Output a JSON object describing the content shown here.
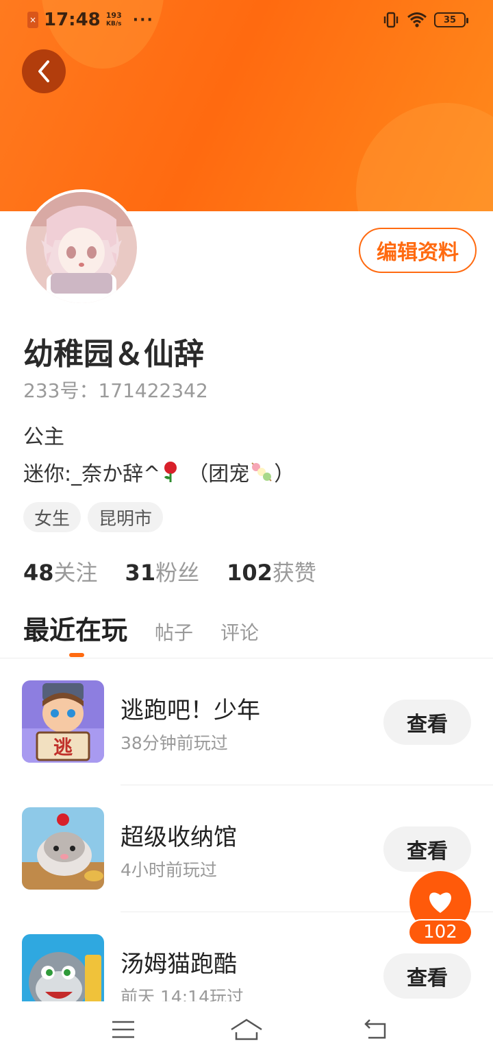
{
  "status_bar": {
    "time": "17:48",
    "speed_value": "193",
    "speed_unit": "KB/s",
    "more": "···",
    "battery": "35"
  },
  "profile": {
    "username": "幼稚园＆仙辞",
    "id_label": "233号：",
    "id_value": "171422342",
    "bio_line1": "公主",
    "bio_line2_prefix": "迷你:_奈か辞^",
    "bio_line2_mid": "（团宠",
    "bio_line2_suffix": "）",
    "tags": [
      "女生",
      "昆明市"
    ],
    "edit_label": "编辑资料"
  },
  "stats": {
    "following_num": "48",
    "following_label": "关注",
    "fans_num": "31",
    "fans_label": "粉丝",
    "likes_num": "102",
    "likes_label": "获赞"
  },
  "tabs": [
    "最近在玩",
    "帖子",
    "评论"
  ],
  "games": [
    {
      "title": "逃跑吧！少年",
      "subtitle": "38分钟前玩过",
      "button": "查看",
      "icon_text": "逃"
    },
    {
      "title": "超级收纳馆",
      "subtitle": "4小时前玩过",
      "button": "查看"
    },
    {
      "title": "汤姆猫跑酷",
      "subtitle": "前天 14:14玩过",
      "button": "查看"
    }
  ],
  "fab": {
    "count": "102"
  },
  "colors": {
    "accent": "#ff6a10",
    "banner": "#ff7a1f"
  }
}
